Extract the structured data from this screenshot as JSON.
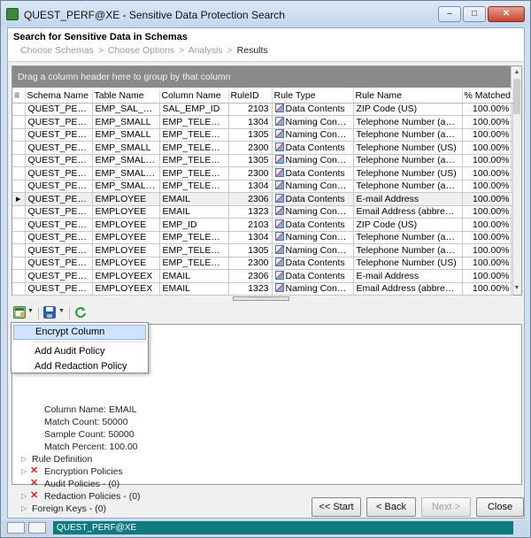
{
  "window": {
    "title": "QUEST_PERF@XE - Sensitive Data Protection Search",
    "min": "–",
    "max": "□",
    "close": "✕"
  },
  "header": {
    "title": "Search for Sensitive Data in Schemas",
    "breadcrumbs": [
      "Choose Schemas",
      ">",
      "Choose Options",
      ">",
      "Analysis",
      ">",
      "Results"
    ]
  },
  "grid": {
    "group_hint": "Drag a column header here to group by that column",
    "columns": [
      "Schema Name",
      "Table Name",
      "Column Name",
      "RuleID",
      "Rule Type",
      "Rule Name",
      "% Matched"
    ],
    "rows": [
      [
        "QUEST_PERF",
        "EMP_SAL_HIST",
        "SAL_EMP_ID",
        "2103",
        "Data Contents",
        "ZIP Code (US)",
        "100.00%"
      ],
      [
        "QUEST_PERF",
        "EMP_SMALL",
        "EMP_TELEPHONE",
        "1304",
        "Naming Convention",
        "Telephone Number (abbreviat",
        "100.00%"
      ],
      [
        "QUEST_PERF",
        "EMP_SMALL",
        "EMP_TELEPHONE",
        "1305",
        "Naming Convention",
        "Telephone Number (abbreviat",
        "100.00%"
      ],
      [
        "QUEST_PERF",
        "EMP_SMALL",
        "EMP_TELEPHONE",
        "2300",
        "Data Contents",
        "Telephone Number (US)",
        "100.00%"
      ],
      [
        "QUEST_PERF",
        "EMP_SMALLX",
        "EMP_TELEPHONE",
        "1305",
        "Naming Convention",
        "Telephone Number (abbreviat",
        "100.00%"
      ],
      [
        "QUEST_PERF",
        "EMP_SMALLX",
        "EMP_TELEPHONE",
        "2300",
        "Data Contents",
        "Telephone Number (US)",
        "100.00%"
      ],
      [
        "QUEST_PERF",
        "EMP_SMALLX",
        "EMP_TELEPHONE",
        "1304",
        "Naming Convention",
        "Telephone Number (abbreviat",
        "100.00%"
      ],
      [
        "QUEST_PERF",
        "EMPLOYEE",
        "EMAIL",
        "2306",
        "Data Contents",
        "E-mail Address",
        "100.00%"
      ],
      [
        "QUEST_PERF",
        "EMPLOYEE",
        "EMAIL",
        "1323",
        "Naming Convention",
        "Email Address (abbreviated)",
        "100.00%"
      ],
      [
        "QUEST_PERF",
        "EMPLOYEE",
        "EMP_ID",
        "2103",
        "Data Contents",
        "ZIP Code (US)",
        "100.00%"
      ],
      [
        "QUEST_PERF",
        "EMPLOYEE",
        "EMP_TELEPHONE",
        "1304",
        "Naming Convention",
        "Telephone Number (abbreviat",
        "100.00%"
      ],
      [
        "QUEST_PERF",
        "EMPLOYEE",
        "EMP_TELEPHONE",
        "1305",
        "Naming Convention",
        "Telephone Number (abbreviat",
        "100.00%"
      ],
      [
        "QUEST_PERF",
        "EMPLOYEE",
        "EMP_TELEPHONE",
        "2300",
        "Data Contents",
        "Telephone Number (US)",
        "100.00%"
      ],
      [
        "QUEST_PERF",
        "EMPLOYEEX",
        "EMAIL",
        "2306",
        "Data Contents",
        "E-mail Address",
        "100.00%"
      ],
      [
        "QUEST_PERF",
        "EMPLOYEEX",
        "EMAIL",
        "1323",
        "Naming Convention",
        "Email Address (abbreviated)",
        "100.00%"
      ]
    ],
    "selected_row": 7
  },
  "context_menu": {
    "items": [
      "Encrypt Column",
      "Add Audit Policy",
      "Add Redaction Policy"
    ],
    "highlighted": 0
  },
  "details": {
    "column_name": "Column Name: EMAIL",
    "match_count": "Match Count: 50000",
    "sample_count": "Sample Count: 50000",
    "match_percent": "Match Percent: 100.00",
    "rule_definition": "Rule Definition",
    "encryption_policies": "Encryption Policies",
    "audit_policies": "Audit Policies - (0)",
    "redaction_policies": "Redaction Policies - (0)",
    "foreign_keys": "Foreign Keys - (0)"
  },
  "buttons": {
    "start": "<< Start",
    "back": "< Back",
    "next": "Next >",
    "close": "Close"
  },
  "status": {
    "connection": "QUEST_PERF@XE"
  },
  "colors": {
    "connection_bar": "#0f7a80",
    "group_bar": "#8a8a8a",
    "menu_highlight": "#cfe3fb"
  }
}
